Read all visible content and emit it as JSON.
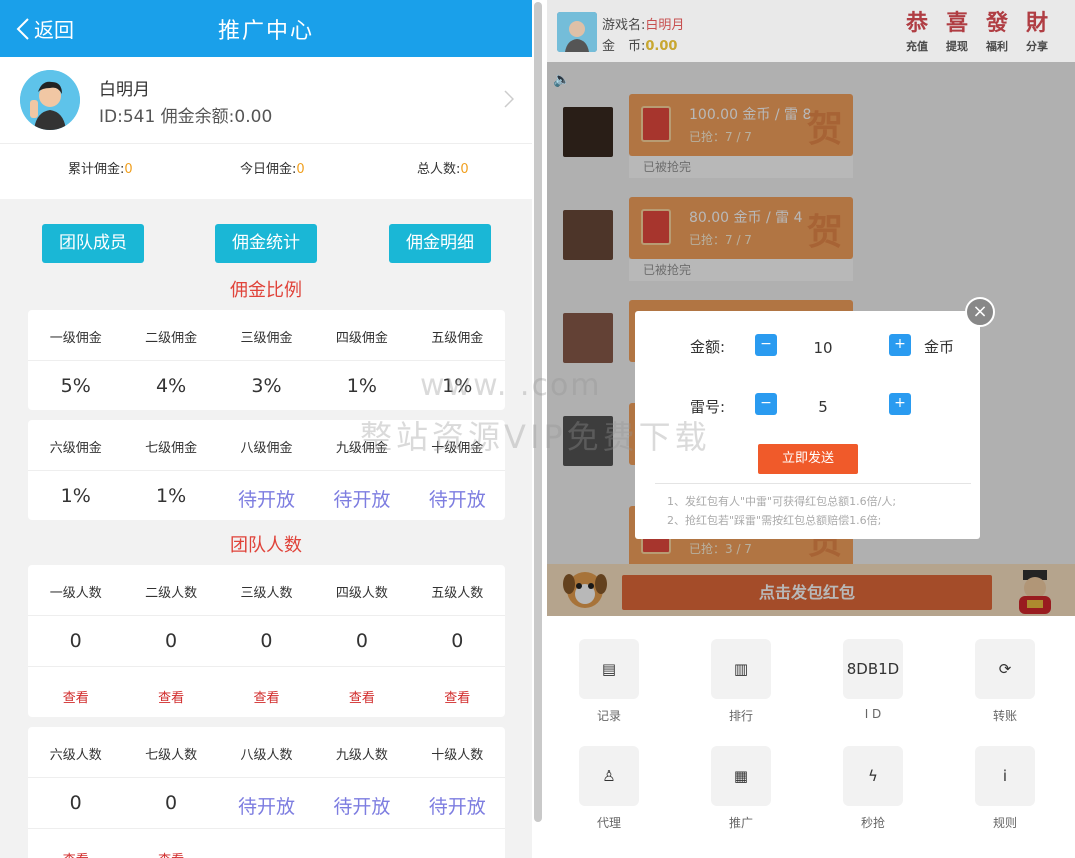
{
  "left": {
    "header": {
      "back_label": "返回",
      "title": "推广中心"
    },
    "profile": {
      "name": "白明月",
      "id_line": "ID:541 佣金余额:0.00"
    },
    "stats": [
      {
        "label": "累计佣金:",
        "value": "0"
      },
      {
        "label": "今日佣金:",
        "value": "0"
      },
      {
        "label": "总人数:",
        "value": "0"
      }
    ],
    "buttons": {
      "team": "团队成员",
      "stats": "佣金统计",
      "detail": "佣金明细"
    },
    "commission_title": "佣金比例",
    "commission_row1": {
      "headers": [
        "一级佣金",
        "二级佣金",
        "三级佣金",
        "四级佣金",
        "五级佣金"
      ],
      "values": [
        "5%",
        "4%",
        "3%",
        "1%",
        "1%"
      ]
    },
    "commission_row2": {
      "headers": [
        "六级佣金",
        "七级佣金",
        "八级佣金",
        "九级佣金",
        "十级佣金"
      ],
      "values": [
        "1%",
        "1%",
        "待开放",
        "待开放",
        "待开放"
      ]
    },
    "team_title": "团队人数",
    "team_row1": {
      "headers": [
        "一级人数",
        "二级人数",
        "三级人数",
        "四级人数",
        "五级人数"
      ],
      "values": [
        "0",
        "0",
        "0",
        "0",
        "0"
      ],
      "view": "查看"
    },
    "team_row2": {
      "headers": [
        "六级人数",
        "七级人数",
        "八级人数",
        "九级人数",
        "十级人数"
      ],
      "values": [
        "0",
        "0",
        "待开放",
        "待开放",
        "待开放"
      ],
      "view": "查看"
    }
  },
  "right": {
    "topbar": {
      "game_name_label": "游戏名:",
      "game_name": "白明月",
      "coins_label": "金　币:",
      "coins": "0.00",
      "actions": [
        {
          "glyph": "恭",
          "label": "充值"
        },
        {
          "glyph": "喜",
          "label": "提现"
        },
        {
          "glyph": "發",
          "label": "福利"
        },
        {
          "glyph": "財",
          "label": "分享"
        }
      ]
    },
    "messages": [
      {
        "amount": "100.00 金币 / 雷 8",
        "grabbed": "已抢：7 / 7",
        "footer": "已被抢完"
      },
      {
        "amount": "80.00 金币 / 雷 4",
        "grabbed": "已抢：7 / 7",
        "footer": "已被抢完"
      },
      {
        "amount": "",
        "grabbed": "已抢：3 / 7",
        "footer": ""
      }
    ],
    "dialog": {
      "amount_label": "金额:",
      "amount_value": "10",
      "amount_unit": "金币",
      "mine_label": "雷号:",
      "mine_value": "5",
      "send_label": "立即发送",
      "rules": [
        "1、发红包有人\"中雷\"可获得红包总额1.6倍/人;",
        "2、抢红包若\"踩雷\"需按红包总额赔偿1.6倍;"
      ],
      "close": "×"
    },
    "send_bar_label": "点击发包红包",
    "menu": [
      {
        "icon": "record-icon",
        "glyph": "▤",
        "label": "记录"
      },
      {
        "icon": "ranking-icon",
        "glyph": "▥",
        "label": "排行"
      },
      {
        "icon": "id-icon",
        "glyph": "8DB1D",
        "label": "I D"
      },
      {
        "icon": "transfer-icon",
        "glyph": "⟳",
        "label": "转账"
      },
      {
        "icon": "agent-icon",
        "glyph": "♙",
        "label": "代理"
      },
      {
        "icon": "qrcode-icon",
        "glyph": "▦",
        "label": "推广"
      },
      {
        "icon": "flash-icon",
        "glyph": "ϟ",
        "label": "秒抢"
      },
      {
        "icon": "info-icon",
        "glyph": "i",
        "label": "规则"
      }
    ]
  },
  "watermark": {
    "url": "www.    .com",
    "text": "整站资源VIP免费下载"
  },
  "colors": {
    "header_blue": "#1aa0ea",
    "button_cyan": "#1ab7d6",
    "accent_red": "#e0433a",
    "pending_purple": "#7d7de0"
  }
}
